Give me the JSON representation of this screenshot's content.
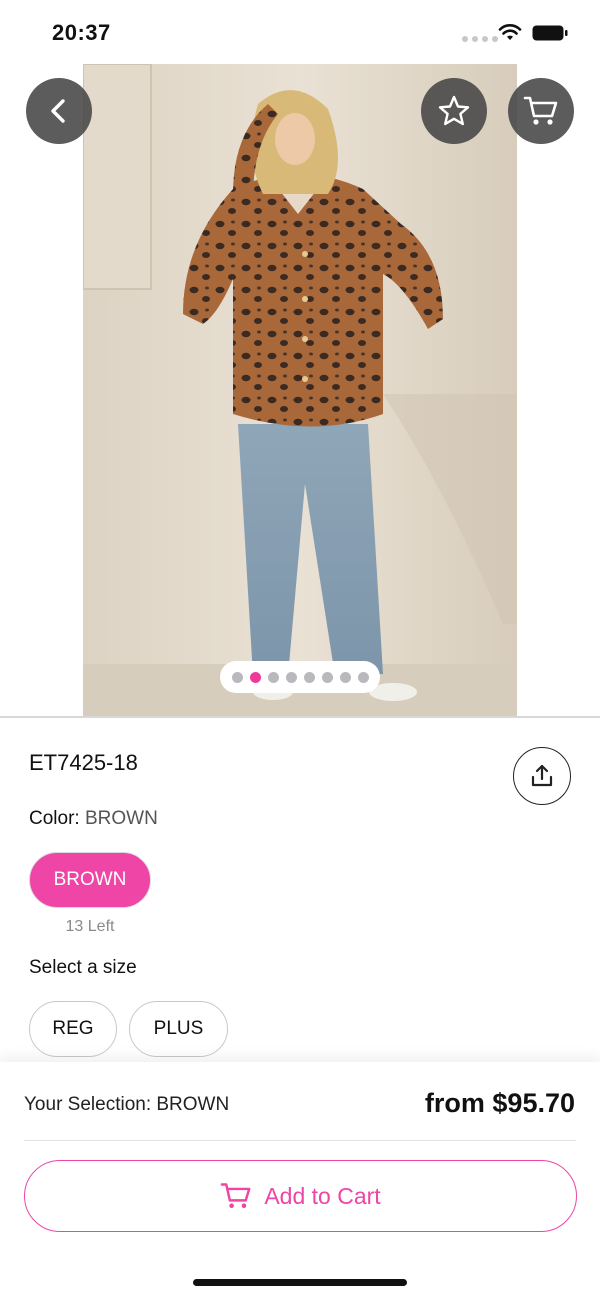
{
  "status_bar": {
    "time": "20:37"
  },
  "product": {
    "sku": "ET7425-18",
    "color_label": "Color:",
    "color_value": "BROWN",
    "color_options": [
      {
        "label": "BROWN",
        "stock": "13 Left"
      }
    ],
    "size_label": "Select a size",
    "sizes": [
      "REG",
      "PLUS"
    ],
    "image_count": 8,
    "active_image_index": 1
  },
  "bottom_bar": {
    "selection_text": "Your Selection: BROWN",
    "price_text": "from $95.70",
    "add_to_cart_label": "Add to Cart"
  },
  "icons": {
    "back": "chevron-left-icon",
    "favorite": "star-icon",
    "cart": "cart-icon",
    "share": "share-icon"
  },
  "colors": {
    "accent": "#ee45a6",
    "pager_active": "#ef3a9a",
    "overlay_button": "#464646"
  }
}
